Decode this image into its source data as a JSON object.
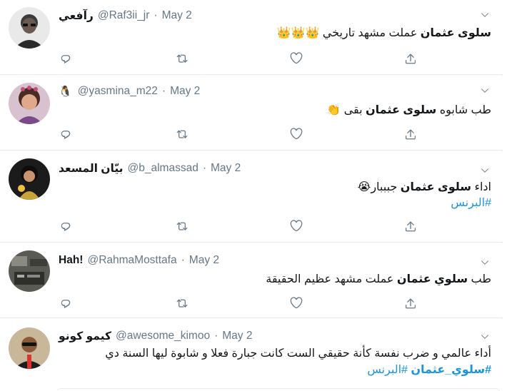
{
  "tweets": [
    {
      "display_name": "رآفعي",
      "handle": "@Raf3ii_jr",
      "separator": "·",
      "date": "May 2",
      "text_bold": "سلوى عثمان",
      "text_rest": " عملت مشهد تاريخي ",
      "text_emoji": "👑👑👑"
    },
    {
      "display_name_emoji": "🐧",
      "handle": "@yasmina_m22",
      "separator": "·",
      "date": "May 2",
      "text_pre": "طب شابوه ",
      "text_bold": "سلوى عثمان",
      "text_rest": " بقى ",
      "text_emoji": "👏"
    },
    {
      "display_name": "بيّان المسعد",
      "handle": "@b_almassad",
      "separator": "·",
      "date": "May 2",
      "text_pre": "اداء ",
      "text_bold": "سلوى عثمان",
      "text_rest": " جبببار",
      "text_emoji": "😭",
      "hashtag": "#البرنس"
    },
    {
      "display_name": "Hah!",
      "handle": "@RahmaMosttafa",
      "separator": "·",
      "date": "May 2",
      "text_pre": "طب ",
      "text_bold": "سلوي عثمان",
      "text_rest": " عملت مشهد عظيم الحقيقة"
    },
    {
      "display_name": "كيمو كونو",
      "handle": "@awesome_kimoo",
      "separator": "·",
      "date": "May 2",
      "text_line1": "أداء عالمي و ضرب نفسة كأنة حقيقي الست كانت جبارة فعلا و شابوة ليها السنة دي",
      "hashtag1": "#سلوي_عثمان",
      "hashtag2": "#البرنس"
    }
  ],
  "icons": {
    "reply": "reply-icon",
    "retweet": "retweet-icon",
    "like": "like-icon",
    "share": "share-icon",
    "chevron": "chevron-down-icon"
  },
  "colors": {
    "text": "#14171a",
    "secondary": "#657786",
    "link": "#1b95e0",
    "border": "#e6ecf0"
  }
}
